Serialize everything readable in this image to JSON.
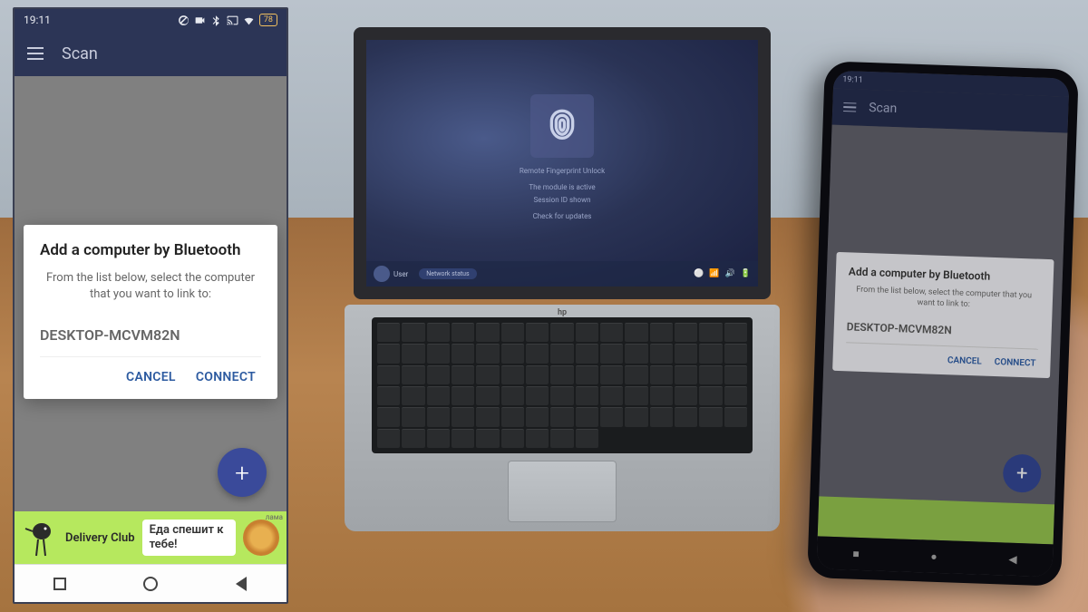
{
  "status": {
    "time": "19:11",
    "battery": "78"
  },
  "appbar": {
    "title": "Scan"
  },
  "dialog": {
    "title": "Add a computer by Bluetooth",
    "body": "From the list below, select the computer that you want to link to:",
    "device": "DESKTOP-MCVM82N",
    "cancel": "CANCEL",
    "connect": "CONNECT"
  },
  "ad": {
    "brand": "Delivery Club",
    "text": "Еда спешит к тебе!",
    "tag": "лама"
  },
  "laptop": {
    "app": "Remote Fingerprint Unlock",
    "line2": "The module is active",
    "line3": "Session ID shown",
    "line4": "Check for updates",
    "user": "User",
    "net": "Network status",
    "logo": "hp"
  }
}
